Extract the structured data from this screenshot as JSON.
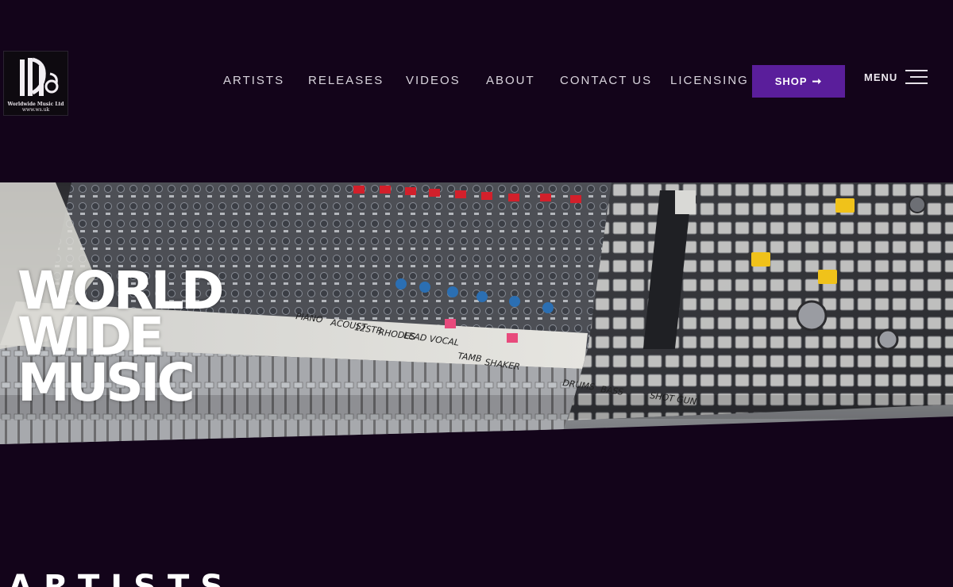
{
  "logo": {
    "line1": "Worldwide Music Ltd",
    "line2": "www.ws.uk"
  },
  "nav": {
    "items": [
      {
        "label": "ARTISTS"
      },
      {
        "label": "RELEASES"
      },
      {
        "label": "VIDEOS"
      },
      {
        "label": "ABOUT"
      },
      {
        "label": "CONTACT US"
      },
      {
        "label": "LICENSING"
      }
    ],
    "shop_label": "SHOP",
    "shop_icon": "arrow-right-icon",
    "menu_label": "MENU",
    "menu_icon": "hamburger-icon"
  },
  "hero": {
    "title_lines": [
      "WORLD",
      "WIDE",
      "MUSIC"
    ],
    "scribbles": [
      "PIANO",
      "ACOUST",
      "12STR",
      "RHODES",
      "LEAD VOCAL",
      "TAMB",
      "SHAKER",
      "DRUMS",
      "BASS",
      "SHOT GUN"
    ]
  },
  "sections": {
    "artists_title": "ARTISTS"
  },
  "colors": {
    "background": "#13041a",
    "accent": "#5a1e9b",
    "text": "#ffffff"
  }
}
